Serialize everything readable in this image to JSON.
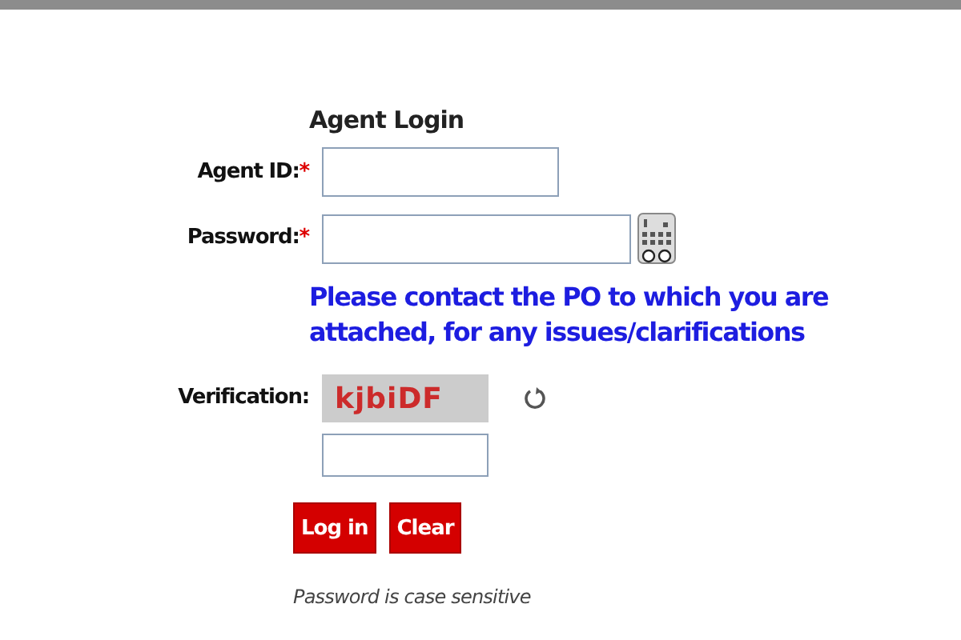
{
  "title": "Agent Login",
  "fields": [
    {
      "label": "Agent ID:",
      "required_mark": "*",
      "kind": "text"
    },
    {
      "label": "Password:",
      "required_mark": "*",
      "kind": "password"
    }
  ],
  "notice": "Please contact the PO to which you are attached, for any issues/clarifications",
  "verification": {
    "label": "Verification:",
    "captcha": "kjbiDF"
  },
  "buttons": [
    "Log in",
    "Clear"
  ],
  "note": "Password is case sensitive"
}
